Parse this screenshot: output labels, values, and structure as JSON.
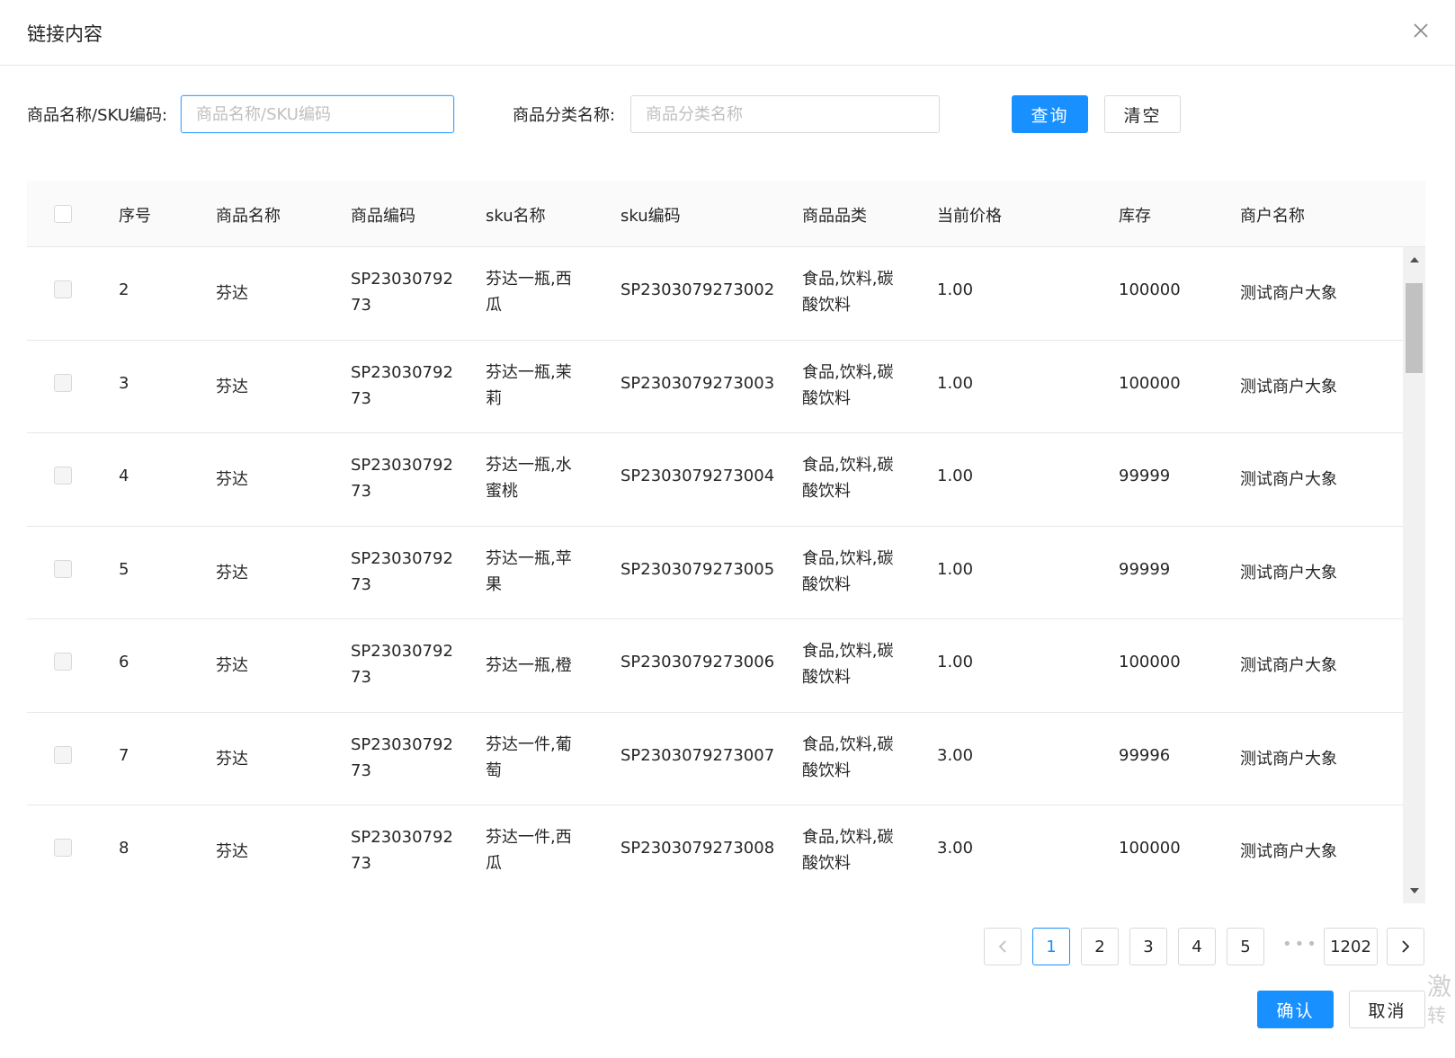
{
  "dialog": {
    "title": "链接内容"
  },
  "filters": {
    "name_label": "商品名称/SKU编码:",
    "name_placeholder": "商品名称/SKU编码",
    "category_label": "商品分类名称:",
    "category_placeholder": "商品分类名称",
    "search_button": "查询",
    "clear_button": "清空"
  },
  "table": {
    "columns": [
      "序号",
      "商品名称",
      "商品编码",
      "sku名称",
      "sku编码",
      "商品品类",
      "当前价格",
      "库存",
      "商户名称"
    ],
    "rows": [
      {
        "index": "2",
        "name": "芬达",
        "code_line1": "SP23030792",
        "code_line2": "73",
        "sku_line1": "芬达一瓶,西",
        "sku_line2": "瓜",
        "sku_code": "SP2303079273002",
        "cat_line1": "食品,饮料,碳",
        "cat_line2": "酸饮料",
        "price": "1.00",
        "stock": "100000",
        "merchant": "测试商户大象"
      },
      {
        "index": "3",
        "name": "芬达",
        "code_line1": "SP23030792",
        "code_line2": "73",
        "sku_line1": "芬达一瓶,茉",
        "sku_line2": "莉",
        "sku_code": "SP2303079273003",
        "cat_line1": "食品,饮料,碳",
        "cat_line2": "酸饮料",
        "price": "1.00",
        "stock": "100000",
        "merchant": "测试商户大象"
      },
      {
        "index": "4",
        "name": "芬达",
        "code_line1": "SP23030792",
        "code_line2": "73",
        "sku_line1": "芬达一瓶,水",
        "sku_line2": "蜜桃",
        "sku_code": "SP2303079273004",
        "cat_line1": "食品,饮料,碳",
        "cat_line2": "酸饮料",
        "price": "1.00",
        "stock": "99999",
        "merchant": "测试商户大象"
      },
      {
        "index": "5",
        "name": "芬达",
        "code_line1": "SP23030792",
        "code_line2": "73",
        "sku_line1": "芬达一瓶,苹",
        "sku_line2": "果",
        "sku_code": "SP2303079273005",
        "cat_line1": "食品,饮料,碳",
        "cat_line2": "酸饮料",
        "price": "1.00",
        "stock": "99999",
        "merchant": "测试商户大象"
      },
      {
        "index": "6",
        "name": "芬达",
        "code_line1": "SP23030792",
        "code_line2": "73",
        "sku_line1": "芬达一瓶,橙",
        "sku_line2": "",
        "sku_code": "SP2303079273006",
        "cat_line1": "食品,饮料,碳",
        "cat_line2": "酸饮料",
        "price": "1.00",
        "stock": "100000",
        "merchant": "测试商户大象"
      },
      {
        "index": "7",
        "name": "芬达",
        "code_line1": "SP23030792",
        "code_line2": "73",
        "sku_line1": "芬达一件,葡",
        "sku_line2": "萄",
        "sku_code": "SP2303079273007",
        "cat_line1": "食品,饮料,碳",
        "cat_line2": "酸饮料",
        "price": "3.00",
        "stock": "99996",
        "merchant": "测试商户大象"
      },
      {
        "index": "8",
        "name": "芬达",
        "code_line1": "SP23030792",
        "code_line2": "73",
        "sku_line1": "芬达一件,西",
        "sku_line2": "瓜",
        "sku_code": "SP2303079273008",
        "cat_line1": "食品,饮料,碳",
        "cat_line2": "酸饮料",
        "price": "3.00",
        "stock": "100000",
        "merchant": "测试商户大象"
      }
    ]
  },
  "pagination": {
    "prev_icon": "chevron-left-icon",
    "pages": [
      "1",
      "2",
      "3",
      "4",
      "5"
    ],
    "ellipsis": "•••",
    "last_page": "1202",
    "next_icon": "chevron-right-icon",
    "current": "1"
  },
  "footer": {
    "confirm_button": "确认",
    "cancel_button": "取消"
  },
  "watermark": {
    "line1": "激",
    "line2": "转"
  },
  "colors": {
    "primary": "#1890ff",
    "border": "#d9d9d9",
    "header_bg": "#fafafa"
  }
}
